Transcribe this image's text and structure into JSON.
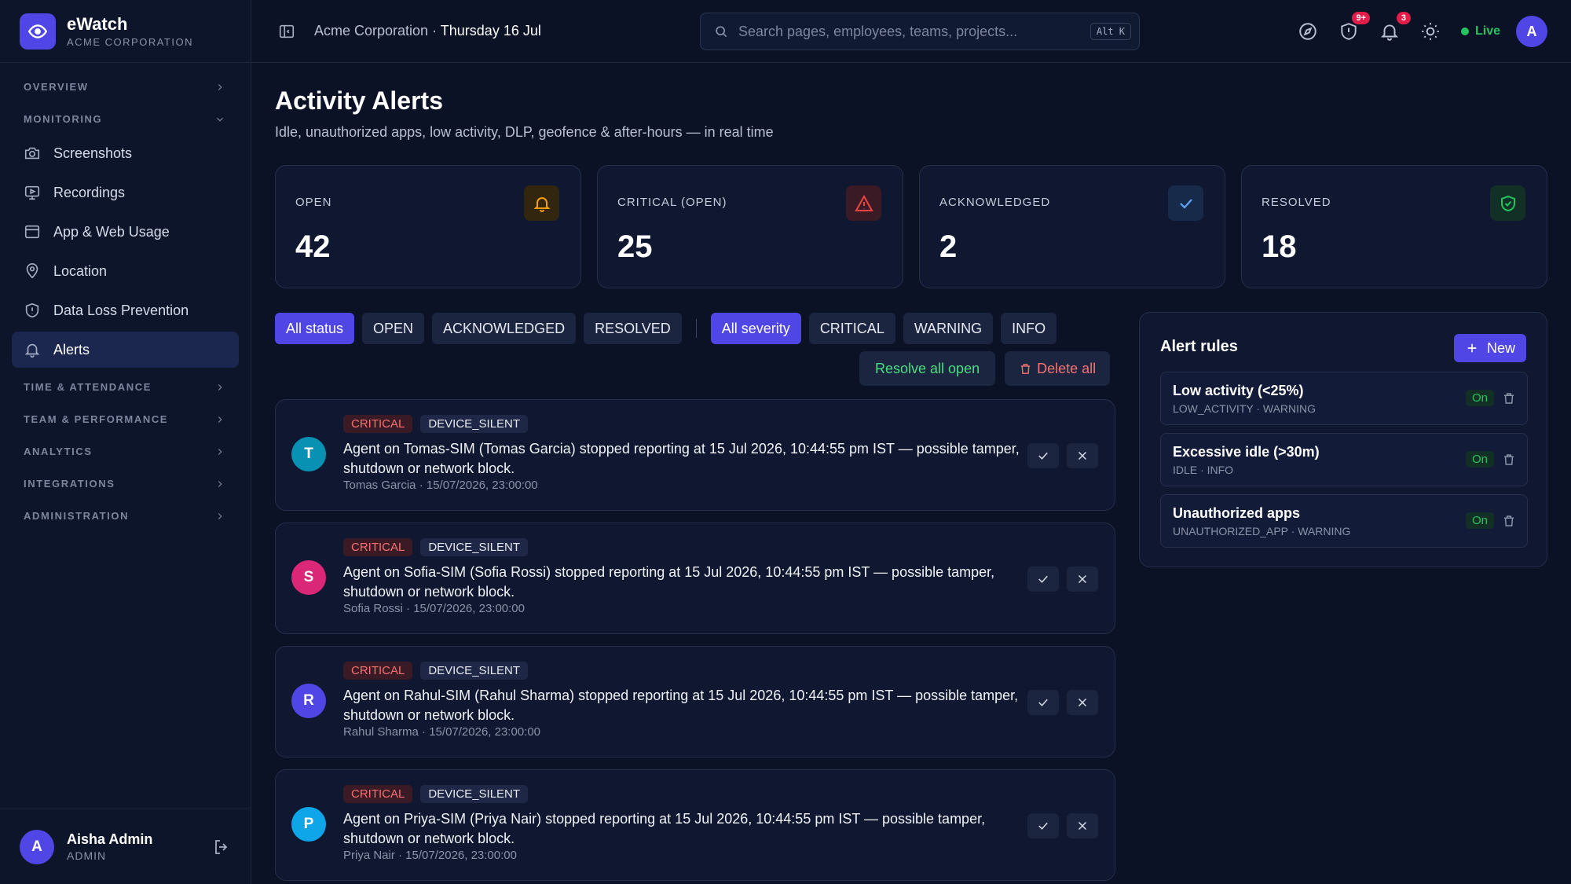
{
  "brand": {
    "name": "eWatch",
    "subtitle": "ACME CORPORATION"
  },
  "topbar": {
    "org": "Acme Corporation",
    "separator": "·",
    "date": "Thursday 16 Jul",
    "search_placeholder": "Search pages, employees, teams, projects...",
    "shortcut": "Alt K",
    "security_badge": "9+",
    "notif_badge": "3",
    "live_label": "Live",
    "avatar_initial": "A"
  },
  "sidebar": {
    "sections": {
      "overview": "OVERVIEW",
      "monitoring": "MONITORING",
      "time": "TIME & ATTENDANCE",
      "team": "TEAM & PERFORMANCE",
      "analytics": "ANALYTICS",
      "integrations": "INTEGRATIONS",
      "administration": "ADMINISTRATION"
    },
    "items": [
      "Screenshots",
      "Recordings",
      "App & Web Usage",
      "Location",
      "Data Loss Prevention",
      "Alerts"
    ],
    "user": {
      "initial": "A",
      "name": "Aisha Admin",
      "role": "ADMIN"
    }
  },
  "page": {
    "title": "Activity Alerts",
    "subtitle": "Idle, unauthorized apps, low activity, DLP, geofence & after-hours — in real time"
  },
  "stats": [
    {
      "label": "OPEN",
      "value": "42",
      "icon": "bell-icon",
      "color": "#f59e0b"
    },
    {
      "label": "CRITICAL (OPEN)",
      "value": "25",
      "icon": "warning-icon",
      "color": "#ef4444"
    },
    {
      "label": "ACKNOWLEDGED",
      "value": "2",
      "icon": "check-icon",
      "color": "#60a5fa"
    },
    {
      "label": "RESOLVED",
      "value": "18",
      "icon": "shield-check-icon",
      "color": "#22c55e"
    }
  ],
  "filters": {
    "status": [
      "All status",
      "OPEN",
      "ACKNOWLEDGED",
      "RESOLVED"
    ],
    "severity": [
      "All severity",
      "CRITICAL",
      "WARNING",
      "INFO"
    ]
  },
  "actions": {
    "resolve_all": "Resolve all open",
    "delete_all": "Delete all"
  },
  "alerts": [
    {
      "initial": "T",
      "avatar_color": "#0891b2",
      "severity": "CRITICAL",
      "type": "DEVICE_SILENT",
      "message": "Agent on Tomas-SIM (Tomas Garcia) stopped reporting at 15 Jul 2026, 10:44:55 pm IST — possible tamper, shutdown or network block.",
      "meta": "Tomas Garcia · 15/07/2026, 23:00:00"
    },
    {
      "initial": "S",
      "avatar_color": "#db2777",
      "severity": "CRITICAL",
      "type": "DEVICE_SILENT",
      "message": "Agent on Sofia-SIM (Sofia Rossi) stopped reporting at 15 Jul 2026, 10:44:55 pm IST — possible tamper, shutdown or network block.",
      "meta": "Sofia Rossi · 15/07/2026, 23:00:00"
    },
    {
      "initial": "R",
      "avatar_color": "#4f46e5",
      "severity": "CRITICAL",
      "type": "DEVICE_SILENT",
      "message": "Agent on Rahul-SIM (Rahul Sharma) stopped reporting at 15 Jul 2026, 10:44:55 pm IST — possible tamper, shutdown or network block.",
      "meta": "Rahul Sharma · 15/07/2026, 23:00:00"
    },
    {
      "initial": "P",
      "avatar_color": "#0ea5e9",
      "severity": "CRITICAL",
      "type": "DEVICE_SILENT",
      "message": "Agent on Priya-SIM (Priya Nair) stopped reporting at 15 Jul 2026, 10:44:55 pm IST — possible tamper, shutdown or network block.",
      "meta": "Priya Nair · 15/07/2026, 23:00:00"
    }
  ],
  "rules": {
    "title": "Alert rules",
    "new_label": "New",
    "items": [
      {
        "name": "Low activity (<25%)",
        "meta": "LOW_ACTIVITY · WARNING",
        "state": "On"
      },
      {
        "name": "Excessive idle (>30m)",
        "meta": "IDLE · INFO",
        "state": "On"
      },
      {
        "name": "Unauthorized apps",
        "meta": "UNAUTHORIZED_APP · WARNING",
        "state": "On"
      }
    ]
  }
}
